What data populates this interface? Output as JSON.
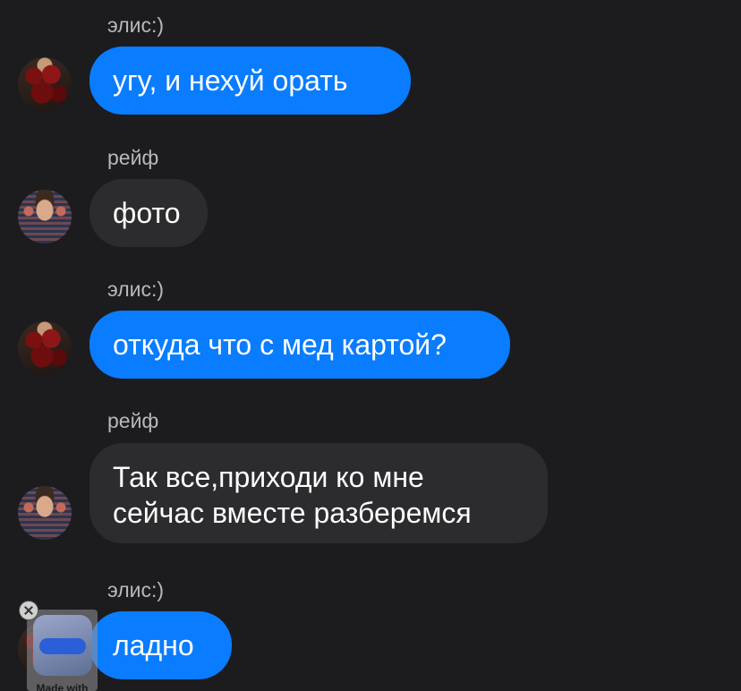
{
  "messages": [
    {
      "sender": "элис:)",
      "text": "угу, и нехуй орать",
      "side": "blue"
    },
    {
      "sender": "рейф",
      "text": "фото",
      "side": "gray"
    },
    {
      "sender": "элис:)",
      "text": "откуда что с мед картой?",
      "side": "blue"
    },
    {
      "sender": "рейф",
      "text": "Так все,приходи ко мне\nсейчас вместе разберемся",
      "side": "gray"
    },
    {
      "sender": "элис:)",
      "text": "ладно",
      "side": "blue"
    }
  ],
  "watermark": {
    "label": "Made with"
  },
  "colors": {
    "background": "#1c1c1e",
    "bubble_blue": "#0a7cff",
    "bubble_gray": "#2c2c2e",
    "sender_text": "#b8b8bc"
  }
}
